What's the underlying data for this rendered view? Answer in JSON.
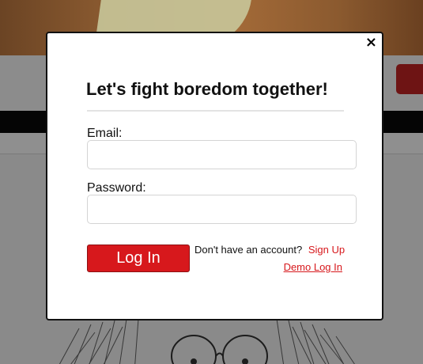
{
  "modal": {
    "title": "Let's fight boredom together!",
    "close_label": "×",
    "email_label": "Email:",
    "email_value": "",
    "email_placeholder": "",
    "password_label": "Password:",
    "password_value": "",
    "password_placeholder": "",
    "login_button_label": "Log In",
    "no_account_text": "Don't have an account?",
    "signup_link_label": "Sign Up",
    "demo_login_label": "Demo Log In"
  },
  "colors": {
    "accent": "#d7181c",
    "overlay": "#8a8a8a",
    "navbar": "#050505"
  }
}
